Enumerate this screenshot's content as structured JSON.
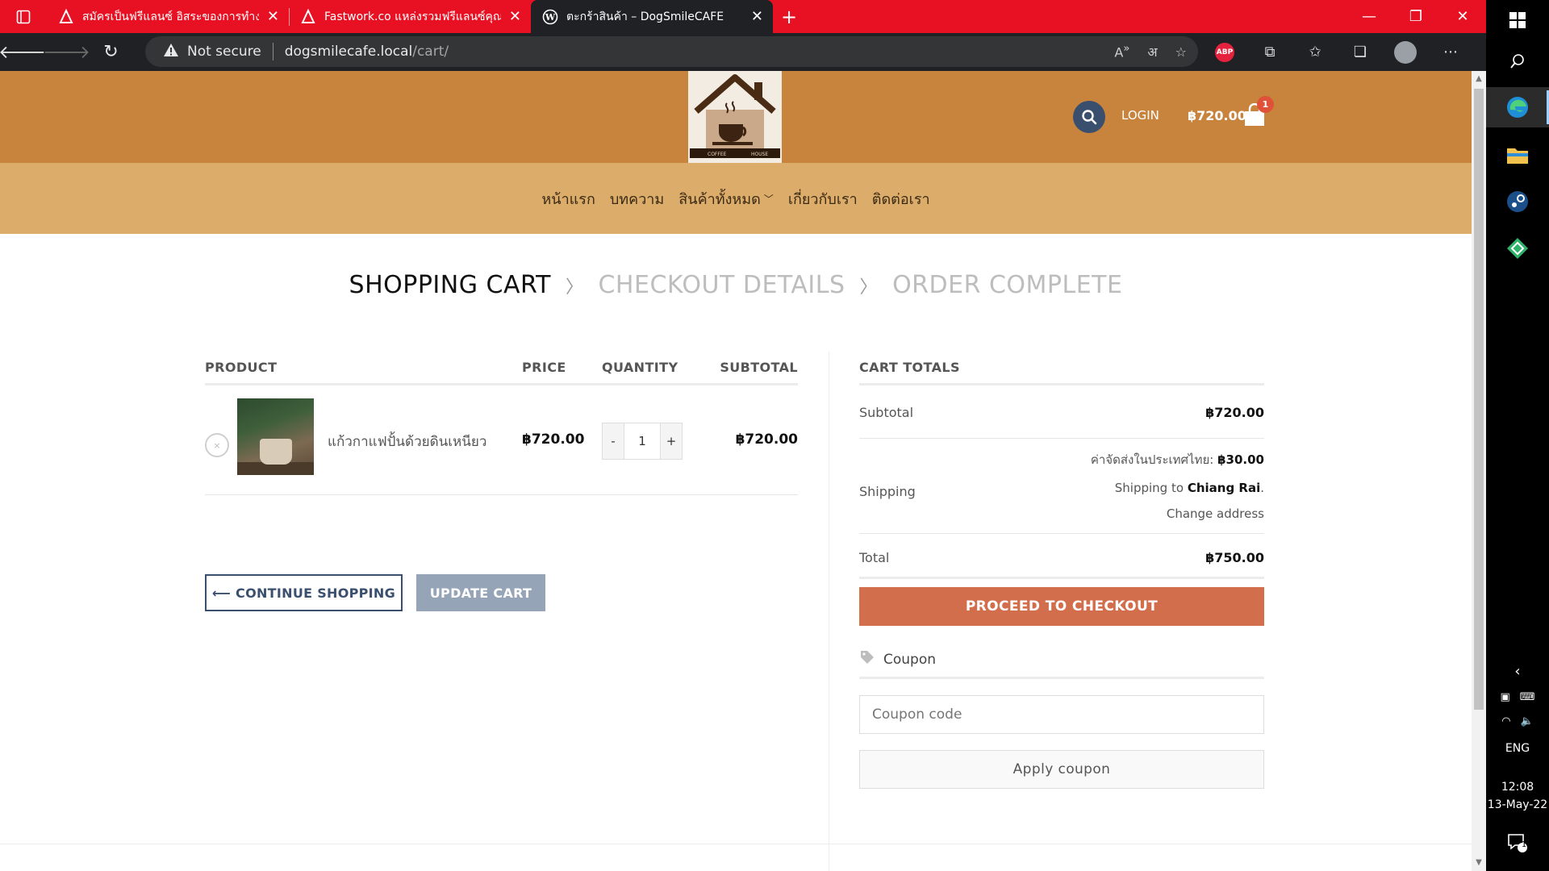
{
  "browser": {
    "tabs": [
      {
        "title": "สมัครเป็นฟรีแลนซ์ อิสระของการทำงาน",
        "active": false
      },
      {
        "title": "Fastwork.co แหล่งรวมฟรีแลนซ์คุณภาพ",
        "active": false
      },
      {
        "title": "ตะกร้าสินค้า – DogSmileCAFE",
        "active": true
      }
    ],
    "security": "Not secure",
    "url_host": "dogsmilecafe.local",
    "url_path": "/cart/",
    "accent": "#e81123"
  },
  "header": {
    "login": "LOGIN",
    "cart_total": "฿720.00",
    "cart_count": "1",
    "logo_text_left": "COFFEE",
    "logo_text_right": "HOUSE"
  },
  "nav": {
    "items": [
      "หน้าแรก",
      "บทความ",
      "สินค้าทั้งหมด",
      "เกี่ยวกับเรา",
      "ติดต่อเรา"
    ]
  },
  "steps": {
    "current": "SHOPPING CART",
    "second": "CHECKOUT DETAILS",
    "third": "ORDER COMPLETE"
  },
  "cart": {
    "columns": {
      "product": "PRODUCT",
      "price": "PRICE",
      "quantity": "QUANTITY",
      "subtotal": "SUBTOTAL"
    },
    "items": [
      {
        "name": "แก้วกาแฟปั้นด้วยดินเหนียว",
        "price": "฿720.00",
        "quantity": "1",
        "subtotal": "฿720.00",
        "remove": "×",
        "minus": "-",
        "plus": "+"
      }
    ],
    "continue_label": "⟵ CONTINUE SHOPPING",
    "update_label": "UPDATE CART"
  },
  "totals": {
    "heading": "CART TOTALS",
    "subtotal_label": "Subtotal",
    "subtotal_value": "฿720.00",
    "shipping_label": "Shipping",
    "shipping_method": "ค่าจัดส่งในประเทศไทย:",
    "shipping_cost": "฿30.00",
    "shipping_to_prefix": "Shipping to",
    "shipping_to_place": "Chiang Rai",
    "change_address": "Change address",
    "total_label": "Total",
    "total_value": "฿750.00",
    "checkout_label": "PROCEED TO CHECKOUT",
    "coupon_heading": "Coupon",
    "coupon_placeholder": "Coupon code",
    "apply_label": "Apply coupon"
  },
  "taskbar": {
    "lang": "ENG",
    "time": "12:08",
    "date": "13-May-22",
    "notif_count": "1"
  }
}
